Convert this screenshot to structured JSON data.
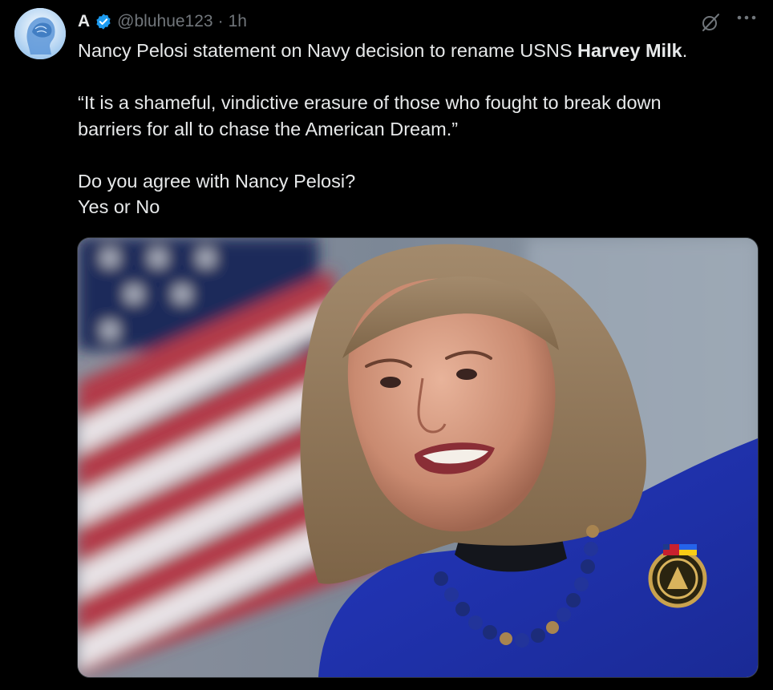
{
  "tweet": {
    "display_name": "A",
    "handle": "@bluhue123",
    "separator": "·",
    "time": "1h",
    "more_icon": "more-horizontal-icon",
    "grok_icon": "grok-icon",
    "text": {
      "line1_before": "Nancy Pelosi statement on Navy decision to rename USNS ",
      "line1_bold": "Harvey Milk",
      "line1_after": ".",
      "quote": "“It is a shameful, vindictive erasure of those who fought to break down barriers for all to chase the American Dream.”",
      "question": "Do you agree with Nancy Pelosi?",
      "options": "Yes or No"
    }
  },
  "colors": {
    "background": "#000000",
    "text": "#e7e9ea",
    "secondary": "#71767b",
    "verified": "#1d9bf0"
  }
}
